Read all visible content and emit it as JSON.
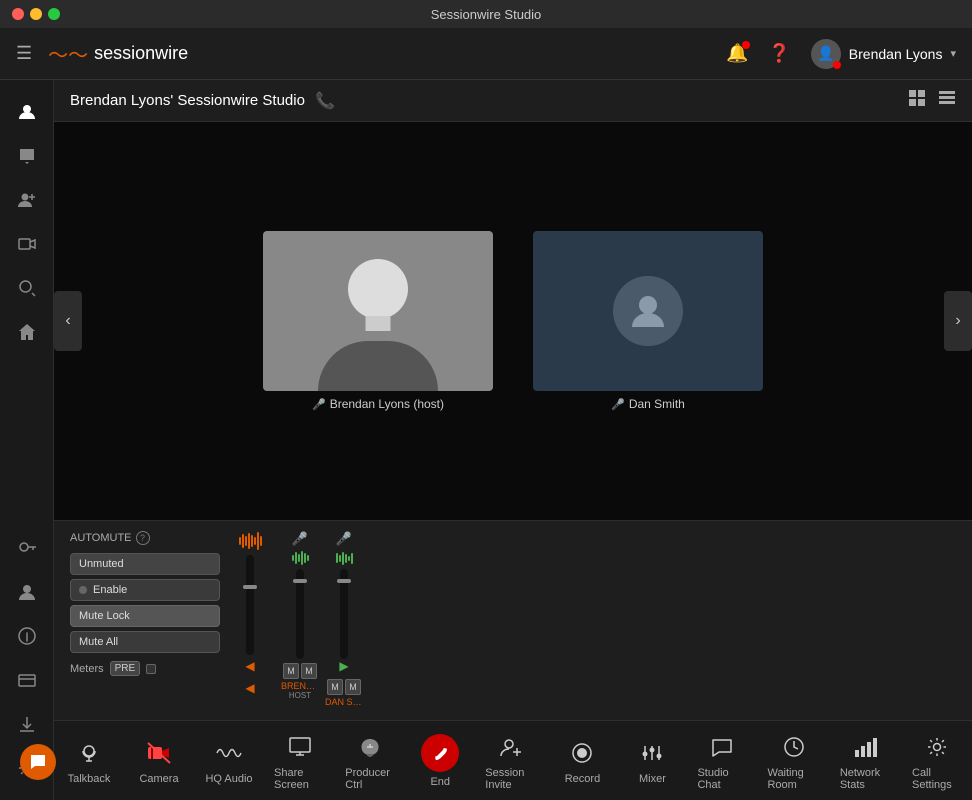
{
  "window": {
    "title": "Sessionwire Studio"
  },
  "titlebar": {
    "dots": [
      "red",
      "yellow",
      "green"
    ]
  },
  "topnav": {
    "logo_text": "sessionwire",
    "user_name": "Brendan Lyons",
    "chevron": "▾"
  },
  "studio": {
    "title": "Brendan Lyons' Sessionwire Studio",
    "view_grid_label": "grid-view",
    "view_list_label": "list-view"
  },
  "participants": [
    {
      "name": "Brendan Lyons (host)",
      "has_photo": true,
      "mic_active": true
    },
    {
      "name": "Dan Smith",
      "has_photo": false,
      "mic_active": true
    }
  ],
  "automute": {
    "title": "AUTOMUTE",
    "unmuted_label": "Unmuted",
    "enable_label": "Enable",
    "mute_lock_label": "Mute Lock",
    "mute_all_label": "Mute All",
    "meters_label": "Meters",
    "pre_label": "PRE"
  },
  "channels": [
    {
      "name": "BRENDAN ...",
      "sublabel": "HOST",
      "color": "#e05a00"
    },
    {
      "name": "DAN SMITH",
      "sublabel": "",
      "color": "#e05a00"
    }
  ],
  "toolbar": {
    "items": [
      {
        "id": "talkback",
        "label": "Talkback",
        "icon": "🎙",
        "color": "normal"
      },
      {
        "id": "camera",
        "label": "Camera",
        "icon": "📷",
        "color": "red"
      },
      {
        "id": "hq-audio",
        "label": "HQ Audio",
        "icon": "〰",
        "color": "normal"
      },
      {
        "id": "share-screen",
        "label": "Share Screen",
        "icon": "🖥",
        "color": "normal"
      },
      {
        "id": "producer-ctrl",
        "label": "Producer Ctrl",
        "icon": "☁",
        "color": "normal"
      },
      {
        "id": "end",
        "label": "End",
        "icon": "📞",
        "color": "red",
        "is_end": true
      },
      {
        "id": "session-invite",
        "label": "Session Invite",
        "icon": "👤",
        "color": "normal"
      },
      {
        "id": "record",
        "label": "Record",
        "icon": "⏺",
        "color": "normal"
      },
      {
        "id": "mixer",
        "label": "Mixer",
        "icon": "🎛",
        "color": "normal"
      },
      {
        "id": "studio-chat",
        "label": "Studio Chat",
        "icon": "💬",
        "color": "normal"
      },
      {
        "id": "waiting-room",
        "label": "Waiting Room",
        "icon": "🕐",
        "color": "normal"
      },
      {
        "id": "network-stats",
        "label": "Network Stats",
        "icon": "📶",
        "color": "normal"
      },
      {
        "id": "call-settings",
        "label": "Call Settings",
        "icon": "⚙",
        "color": "normal"
      }
    ]
  },
  "sidebar": {
    "items": [
      {
        "id": "menu",
        "icon": "☰"
      },
      {
        "id": "user",
        "icon": "👤"
      },
      {
        "id": "chat",
        "icon": "💬"
      },
      {
        "id": "add-user",
        "icon": "👥"
      },
      {
        "id": "video",
        "icon": "🎬"
      },
      {
        "id": "search",
        "icon": "🔍"
      },
      {
        "id": "home",
        "icon": "🏠"
      },
      {
        "id": "key",
        "icon": "🔑"
      },
      {
        "id": "person",
        "icon": "👤"
      },
      {
        "id": "info",
        "icon": "ℹ"
      },
      {
        "id": "card",
        "icon": "💳"
      },
      {
        "id": "download",
        "icon": "⬇"
      },
      {
        "id": "settings",
        "icon": "⚙"
      }
    ]
  }
}
